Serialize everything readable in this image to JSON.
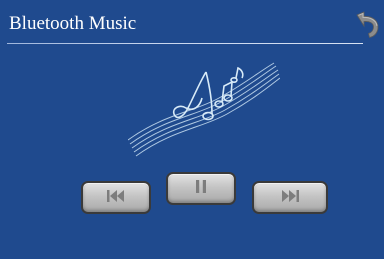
{
  "header": {
    "title": "Bluetooth Music"
  },
  "icons": {
    "back": "back-arrow-icon",
    "art": "music-notes-staff-icon",
    "previous": "previous-track-icon",
    "pause": "pause-icon",
    "next": "next-track-icon"
  },
  "colors": {
    "background": "#1f4a8e",
    "title_text": "#ffffff",
    "button_face": "#c4c4c4",
    "back_arrow": "#8c8c8c",
    "artwork": "#c9e0f2"
  }
}
